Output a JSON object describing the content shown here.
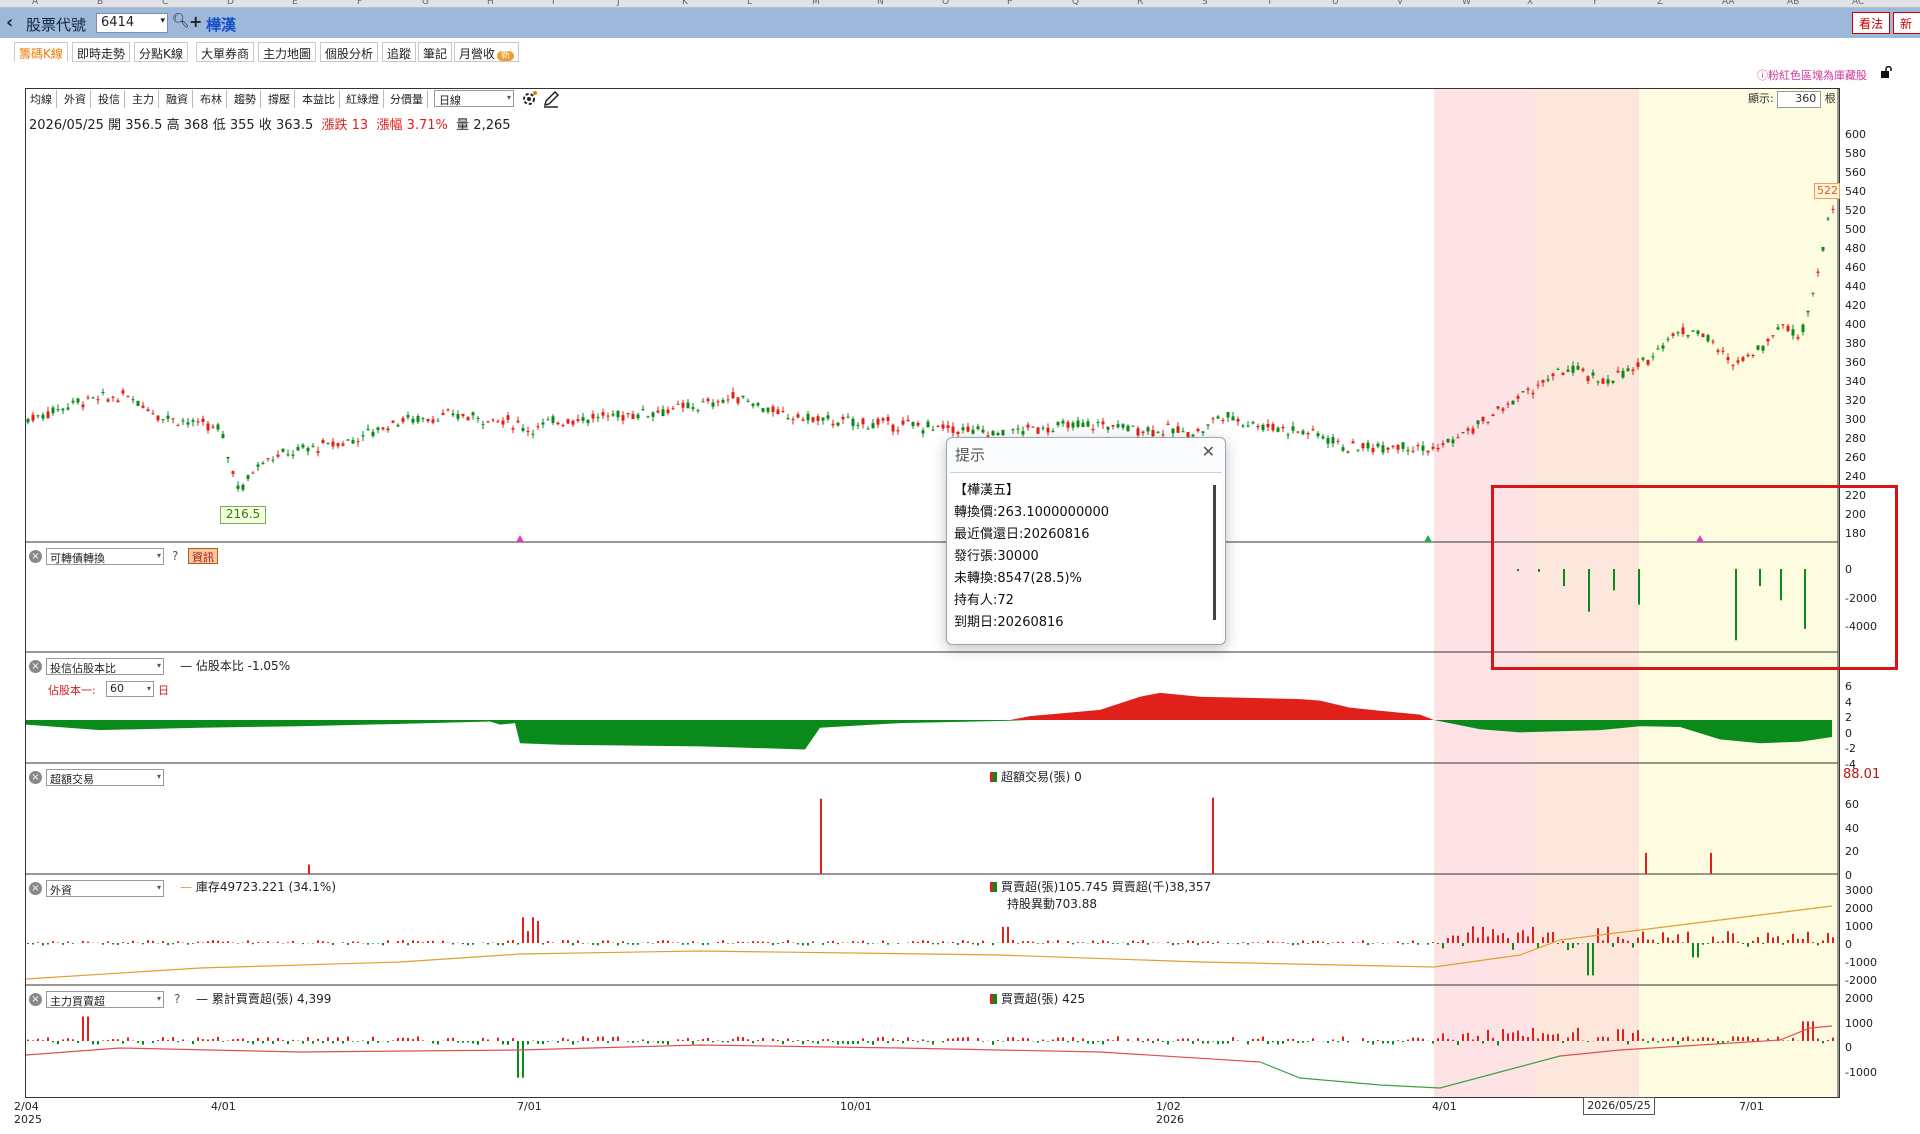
{
  "column_letters": [
    "A",
    "B",
    "C",
    "D",
    "E",
    "F",
    "G",
    "H",
    "I",
    "J",
    "K",
    "L",
    "M",
    "N",
    "O",
    "P",
    "Q",
    "R",
    "S",
    "T",
    "U",
    "V",
    "W",
    "X",
    "Y",
    "Z",
    "AA",
    "AB",
    "AC"
  ],
  "titlebar": {
    "label": "股票代號",
    "code": "6414",
    "stock_name": "樺漢",
    "btn_view": "看法",
    "btn_new": "新"
  },
  "tabs": [
    {
      "label": "籌碼K線",
      "active": true
    },
    {
      "label": "即時走勢",
      "active": false
    },
    {
      "label": "分點K線",
      "active": false
    },
    {
      "label": "大單券商",
      "active": false
    },
    {
      "label": "主力地圖",
      "active": false
    },
    {
      "label": "個股分析",
      "active": false
    },
    {
      "label": "追蹤",
      "active": false
    },
    {
      "label": "筆記",
      "active": false
    },
    {
      "label": "月營收",
      "active": false,
      "badge": "新"
    }
  ],
  "hint_link": "ⓘ粉紅色區塊為庫藏股",
  "toolbar": {
    "items": [
      "均線",
      "外資",
      "投信",
      "主力",
      "融資",
      "布林",
      "趨勢",
      "撐壓",
      "本益比",
      "紅綠燈",
      "分價量"
    ],
    "period": "日線",
    "display_label": "顯示:",
    "display_value": "360",
    "display_unit": "根"
  },
  "ohlc": {
    "date": "2026/05/25",
    "open_label": "開",
    "open": "356.5",
    "high_label": "高",
    "high": "368",
    "low_label": "低",
    "low": "355",
    "close_label": "收",
    "close": "363.5",
    "change": "漲跌 13",
    "pct": "漲幅 3.71%",
    "vol_label": "量",
    "vol": "2,265"
  },
  "price_axis": {
    "ticks": [
      "600",
      "580",
      "560",
      "540",
      "520",
      "500",
      "480",
      "460",
      "440",
      "420",
      "400",
      "380",
      "360",
      "340",
      "320",
      "300",
      "280",
      "260",
      "240",
      "220",
      "200",
      "180"
    ]
  },
  "last_price_tag": "522",
  "low_price_tag": "216.5",
  "panels": {
    "cb": {
      "select": "可轉債轉換",
      "qmark": "?",
      "info_btn": "資訊",
      "ticks": [
        "0",
        "-2000",
        "-4000"
      ]
    },
    "trust": {
      "select": "投信佔股本比",
      "legend": "佔股本比 -1.05%",
      "est_label": "佔股本一:",
      "est_value": "60",
      "est_unit": "日",
      "ticks": [
        "6",
        "4",
        "2",
        "0",
        "-2",
        "-4"
      ]
    },
    "margin": {
      "select": "超額交易",
      "legend": "超額交易(張) 0",
      "ticks": [
        "60",
        "40",
        "20",
        "0"
      ],
      "top_value": "88.01"
    },
    "foreign": {
      "select": "外資",
      "legend": "庫存49723.221 (34.1%)",
      "legend2": "買賣超(張)105.745 買賣超(千)38,357",
      "legend3": "持股異動703.88",
      "ticks": [
        "3000",
        "2000",
        "1000",
        "0",
        "-1000",
        "-2000"
      ]
    },
    "main": {
      "select": "主力買賣超",
      "qmark": "?",
      "legend": "累計買賣超(張) 4,399",
      "legend2": "買賣超(張) 425",
      "ticks": [
        "2000",
        "1000",
        "0",
        "-1000"
      ]
    }
  },
  "x_axis": {
    "labels": [
      {
        "text": "2/04",
        "sub": "2025"
      },
      {
        "text": "4/01",
        "sub": ""
      },
      {
        "text": "7/01",
        "sub": ""
      },
      {
        "text": "10/01",
        "sub": ""
      },
      {
        "text": "1/02",
        "sub": "2026"
      },
      {
        "text": "4/01",
        "sub": ""
      },
      {
        "text": "7/01",
        "sub": ""
      }
    ],
    "cursor_date": "2026/05/25"
  },
  "dialog": {
    "title": "提示",
    "lines": [
      "【樺漢五】",
      "轉換價:263.1000000000",
      "最近償還日:20260816",
      "發行張:30000",
      "未轉換:8547(28.5)%",
      "持有人:72",
      "到期日:20260816"
    ]
  },
  "colors": {
    "up": "#e0201a",
    "down": "#0a8a1a",
    "pink_zone": "#fde3e6",
    "peach_zone": "#fde6dc",
    "yellow_zone": "#fdfbe0",
    "titlebar": "#9db8d9"
  }
}
